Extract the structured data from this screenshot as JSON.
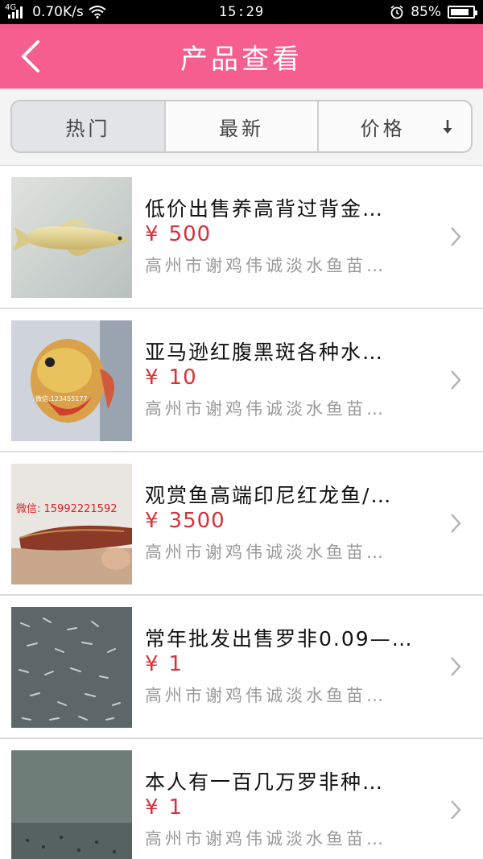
{
  "status_bar": {
    "network": "4G",
    "speed": "0.70K/s",
    "time": "15:29",
    "battery": "85%",
    "battery_level": 0.85
  },
  "header": {
    "title": "产品查看"
  },
  "sort_tabs": [
    {
      "label": "热门",
      "active": true
    },
    {
      "label": "最新",
      "active": false
    },
    {
      "label": "价格",
      "active": false
    }
  ],
  "products": [
    {
      "name": "低价出售养高背过背金…",
      "currency": "¥",
      "price": "500",
      "seller": "高州市谢鸡伟诚淡水鱼苗…",
      "thumb_caption": ""
    },
    {
      "name": "亚马逊红腹黑斑各种水…",
      "currency": "¥",
      "price": "10",
      "seller": "高州市谢鸡伟诚淡水鱼苗…",
      "thumb_caption": "微信:123455177"
    },
    {
      "name": "观赏鱼高端印尼红龙鱼/…",
      "currency": "¥",
      "price": "3500",
      "seller": "高州市谢鸡伟诚淡水鱼苗…",
      "thumb_caption": "微信: 15992221592"
    },
    {
      "name": "常年批发出售罗非0.09—…",
      "currency": "¥",
      "price": "1",
      "seller": "高州市谢鸡伟诚淡水鱼苗…",
      "thumb_caption": ""
    },
    {
      "name": "本人有一百几万罗非种…",
      "currency": "¥",
      "price": "1",
      "seller": "高州市谢鸡伟诚淡水鱼苗…",
      "thumb_caption": ""
    }
  ],
  "colors": {
    "header": "#f55e8f",
    "price": "#d9303a"
  }
}
